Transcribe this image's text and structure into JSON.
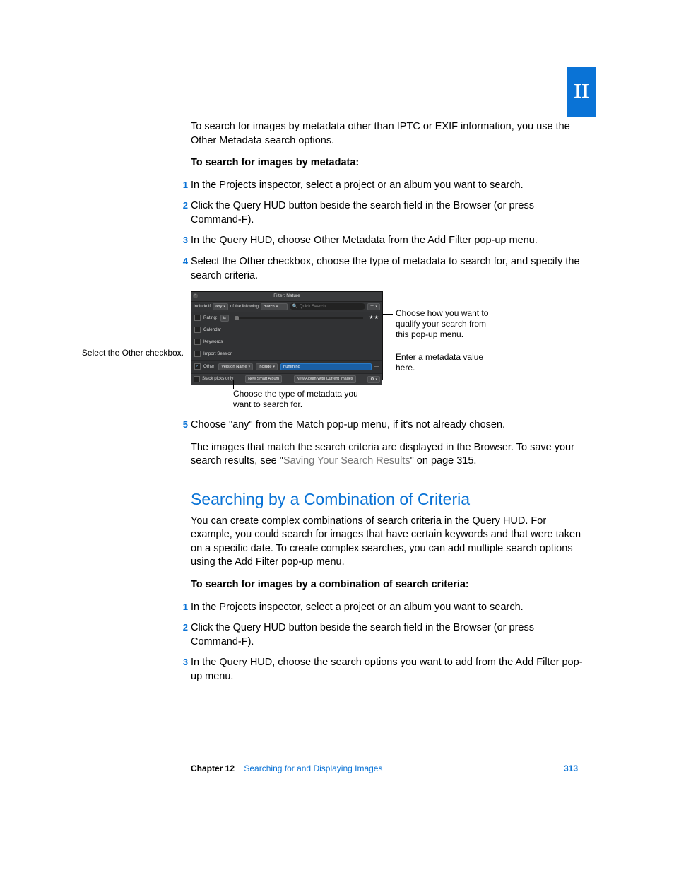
{
  "tab_label": "II",
  "intro": "To search for images by metadata other than IPTC or EXIF information, you use the Other Metadata search options.",
  "procA_title": "To search for images by metadata:",
  "procA_steps": [
    "In the Projects inspector, select a project or an album you want to search.",
    "Click the Query HUD button beside the search field in the Browser (or press Command-F).",
    "In the Query HUD, choose Other Metadata from the Add Filter pop-up menu.",
    "Select the Other checkbox, choose the type of metadata to search for, and specify the search criteria."
  ],
  "hud": {
    "title": "Filter: Nature",
    "include_if": "Include if",
    "any": "any",
    "of_following": "of the following",
    "match": "match",
    "quick_search": "Quick Search…",
    "rows": {
      "rating": "Rating:",
      "is": "is",
      "calendar": "Calendar",
      "keywords": "Keywords",
      "import_session": "Import Session",
      "other": "Other:",
      "version_name": "Version Name",
      "include": "include",
      "humming": "humming",
      "stack_picks": "Stack picks only"
    },
    "buttons": {
      "new_smart_album": "New Smart Album",
      "new_album_current": "New Album With Current Images"
    }
  },
  "callouts": {
    "left": "Select the Other checkbox.",
    "right1": "Choose how you want to qualify your search from this pop-up menu.",
    "right2": "Enter a metadata value here.",
    "bottom": "Choose the type of metadata you want to search for."
  },
  "procA_step5": "Choose \"any\" from the Match pop-up menu, if it's not already chosen.",
  "after5a": "The images that match the search criteria are displayed in the Browser. To save your search results, see \"",
  "after5_link": "Saving Your Search Results",
  "after5b": "\" on page 315.",
  "h2": "Searching by a Combination of Criteria",
  "h2_intro": "You can create complex combinations of search criteria in the Query HUD. For example, you could search for images that have certain keywords and that were taken on a specific date. To create complex searches, you can add multiple search options using the Add Filter pop-up menu.",
  "procB_title": "To search for images by a combination of search criteria:",
  "procB_steps": [
    "In the Projects inspector, select a project or an album you want to search.",
    "Click the Query HUD button beside the search field in the Browser (or press Command-F).",
    "In the Query HUD, choose the search options you want to add from the Add Filter pop-up menu."
  ],
  "footer": {
    "chapter": "Chapter 12",
    "title": "Searching for and Displaying Images",
    "page": "313"
  }
}
